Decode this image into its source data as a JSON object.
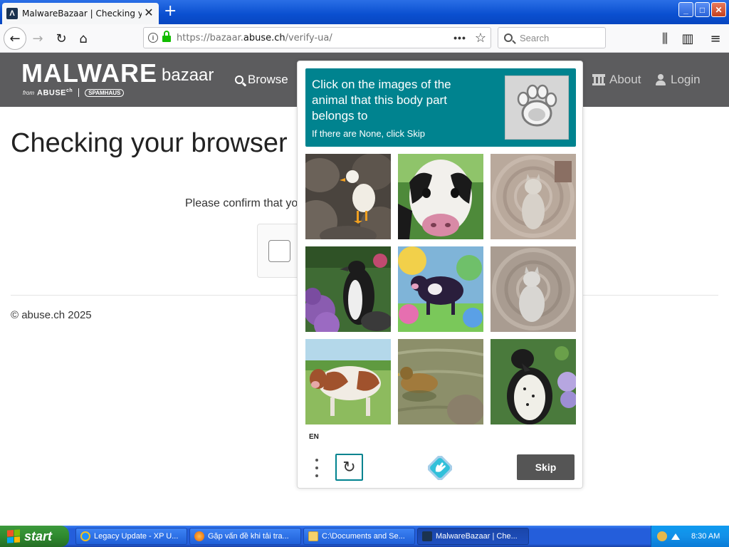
{
  "browser": {
    "tab_title": "MalwareBazaar | Checking your bro",
    "url_prefix": "https://bazaar.",
    "url_domain": "abuse.ch",
    "url_path": "/verify-ua/",
    "search_placeholder": "Search",
    "tab_close": "✕",
    "new_tab": "+",
    "back_glyph": "←",
    "forward_glyph": "→",
    "reload_glyph": "↻",
    "home_glyph": "⌂",
    "page_actions": "•••",
    "bookmark_glyph": "☆",
    "library_glyph": "⫼",
    "sidebar_glyph": "▥",
    "menu_glyph": "≡",
    "window_buttons": {
      "minimize": "_",
      "maximize": "□",
      "close": "✕"
    }
  },
  "site": {
    "logo_main": "MALWARE",
    "logo_sub": "bazaar",
    "logo_from": "from",
    "logo_abuse": "ABUSE",
    "logo_abuse_sup": "ch",
    "logo_spamhaus": "SPAMHAUS",
    "nav": {
      "browse": "Browse",
      "about": "About",
      "login": "Login"
    },
    "page_title": "Checking your browser",
    "confirm_text": "Please confirm that you",
    "footer": "© abuse.ch 2025"
  },
  "challenge": {
    "prompt_main": "Click on the images of the animal that this body part belongs to",
    "prompt_sub": "If there are None, click Skip",
    "example_icon": "paw-print",
    "tiles": [
      {
        "icon": "duck-on-rocks"
      },
      {
        "icon": "cow-face"
      },
      {
        "icon": "cat-distorted"
      },
      {
        "icon": "penguin-flowers"
      },
      {
        "icon": "cow-colorful"
      },
      {
        "icon": "cat-distorted"
      },
      {
        "icon": "cow-field"
      },
      {
        "icon": "duck-water"
      },
      {
        "icon": "penguin-flowers"
      }
    ],
    "language": "EN",
    "skip_label": "Skip",
    "refresh_glyph": "↻",
    "brand_color": "#00838f"
  },
  "taskbar": {
    "start_label": "start",
    "tasks": [
      {
        "label": "Legacy Update - XP U...",
        "icon": "ie-icon"
      },
      {
        "label": "Gặp vấn đề khi tải tra...",
        "icon": "firefox-icon"
      },
      {
        "label": "C:\\Documents and Se...",
        "icon": "folder-icon"
      },
      {
        "label": "MalwareBazaar | Che...",
        "icon": "malwarebazaar-icon"
      }
    ],
    "clock": "8:30 AM"
  }
}
